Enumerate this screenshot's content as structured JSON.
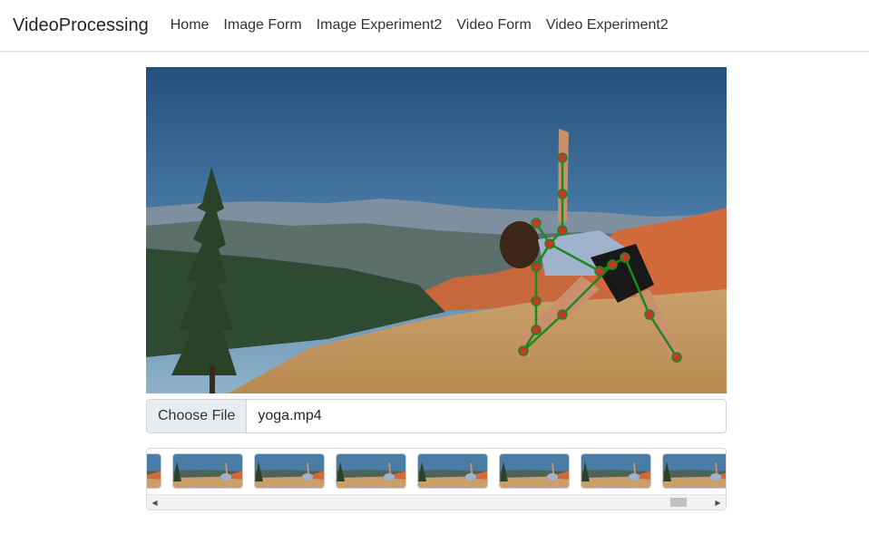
{
  "navbar": {
    "brand": "VideoProcessing",
    "links": [
      "Home",
      "Image Form",
      "Image Experiment2",
      "Video Form",
      "Video Experiment2"
    ]
  },
  "video": {
    "frame_icon": "yoga-pose-frame",
    "overlay_color": "#1a8a1a",
    "joint_color": "#c0392b"
  },
  "file_input": {
    "button_label": "Choose File",
    "file_name": "yoga.mp4"
  },
  "thumbnails": {
    "count_visible": 8
  },
  "scrollbar": {
    "left_icon": "triangle-left-icon",
    "right_icon": "triangle-right-icon",
    "left_glyph": "◀",
    "right_glyph": "▶"
  }
}
